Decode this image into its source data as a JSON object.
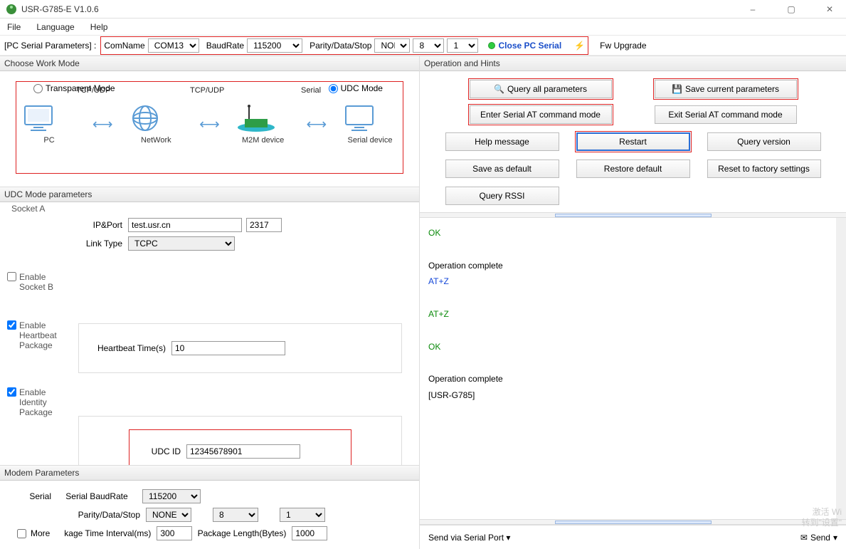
{
  "window": {
    "title": "USR-G785-E V1.0.6",
    "minimize": "–",
    "maximize": "▢",
    "close": "✕"
  },
  "menu": {
    "file": "File",
    "language": "Language",
    "help": "Help"
  },
  "serialbar": {
    "group_label": "[PC Serial Parameters] :",
    "comname_label": "ComName",
    "comname_value": "COM13",
    "baud_label": "BaudRate",
    "baud_value": "115200",
    "pds_label": "Parity/Data/Stop",
    "parity_value": "NONE",
    "data_value": "8",
    "stop_value": "1",
    "close_serial": "Close PC Serial",
    "fw_upgrade": "Fw Upgrade"
  },
  "workmode": {
    "header": "Choose Work Mode",
    "transparent": "Transparent Mode",
    "udc": "UDC Mode",
    "diagram_labels": {
      "tcp1": "TCP/UDP",
      "tcp2": "TCP/UDP",
      "serial": "Serial"
    },
    "devices": {
      "pc": "PC",
      "network": "NetWork",
      "m2m": "M2M device",
      "serialdev": "Serial device"
    }
  },
  "udc": {
    "header": "UDC Mode parameters",
    "socket_a": "Socket A",
    "ipport_label": "IP&Port",
    "ip_value": "test.usr.cn",
    "port_value": "2317",
    "link_label": "Link Type",
    "link_value": "TCPC",
    "enable_socket_b": "Enable Socket B",
    "enable_heartbeat": "Enable Heartbeat Package",
    "heartbeat_time_label": "Heartbeat Time(s)",
    "heartbeat_time_value": "10",
    "enable_identity": "Enable Identity Package",
    "udc_id_label": "UDC ID",
    "udc_id_value": "12345678901"
  },
  "modem": {
    "header": "Modem Parameters",
    "serial_label": "Serial",
    "baud_label": "Serial BaudRate",
    "baud_value": "115200",
    "pds_label": "Parity/Data/Stop",
    "parity_value": "NONE",
    "data_value": "8",
    "stop_value": "1",
    "interval_label": "kage Time Interval(ms)",
    "interval_value": "300",
    "pkglen_label": "Package Length(Bytes)",
    "pkglen_value": "1000",
    "more": "More"
  },
  "ops": {
    "header": "Operation and Hints",
    "query_all": "Query all parameters",
    "save_current": "Save current parameters",
    "enter_at": "Enter Serial AT command mode",
    "exit_at": "Exit Serial AT command mode",
    "help": "Help message",
    "restart": "Restart",
    "query_version": "Query version",
    "save_default": "Save as default",
    "restore_default": "Restore default",
    "reset_factory": "Reset to factory settings",
    "query_rssi": "Query RSSI"
  },
  "log": [
    {
      "cls": "green",
      "text": "OK"
    },
    {
      "cls": "black",
      "text": ""
    },
    {
      "cls": "black",
      "text": "Operation complete"
    },
    {
      "cls": "blue",
      "text": "AT+Z"
    },
    {
      "cls": "black",
      "text": ""
    },
    {
      "cls": "green",
      "text": "AT+Z"
    },
    {
      "cls": "black",
      "text": ""
    },
    {
      "cls": "green",
      "text": "OK"
    },
    {
      "cls": "black",
      "text": ""
    },
    {
      "cls": "black",
      "text": "Operation complete"
    },
    {
      "cls": "black",
      "text": "[USR-G785]"
    }
  ],
  "sendbar": {
    "via": "Send via Serial Port",
    "send": "Send"
  },
  "watermark": {
    "l1": "激活 Wi",
    "l2": "转到\"设置\""
  }
}
